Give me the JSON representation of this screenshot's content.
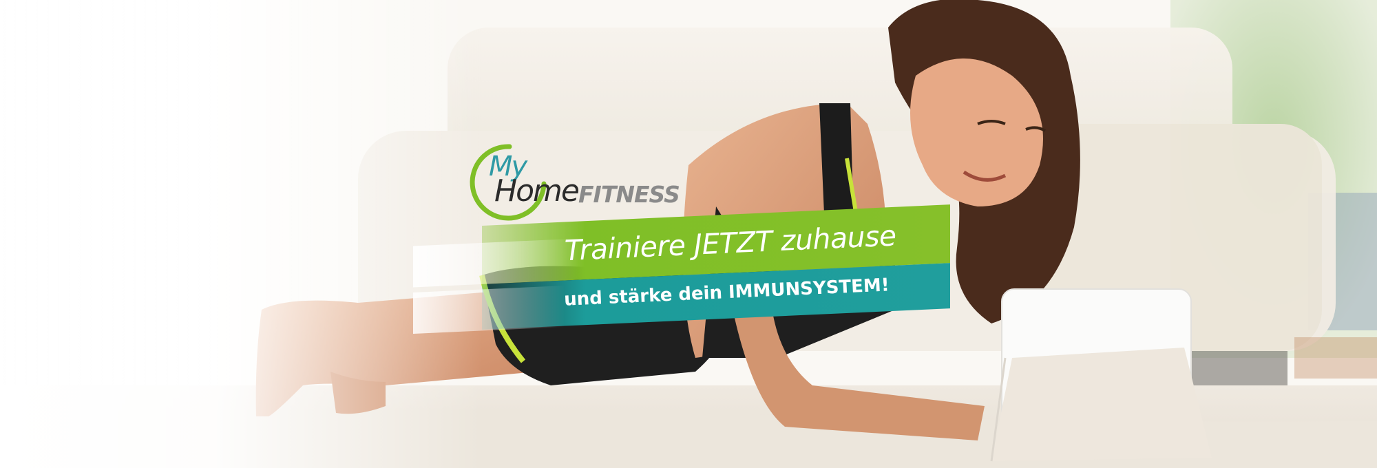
{
  "logo": {
    "my": "My",
    "home": "Home",
    "fitness": "FITNESS"
  },
  "banner": {
    "headline": "Trainiere JETZT zuhause",
    "subline": "und stärke dein IMMUNSYSTEM!"
  },
  "colors": {
    "green": "#86c02a",
    "teal": "#209e9d",
    "logo_teal": "#2f9aa5"
  }
}
